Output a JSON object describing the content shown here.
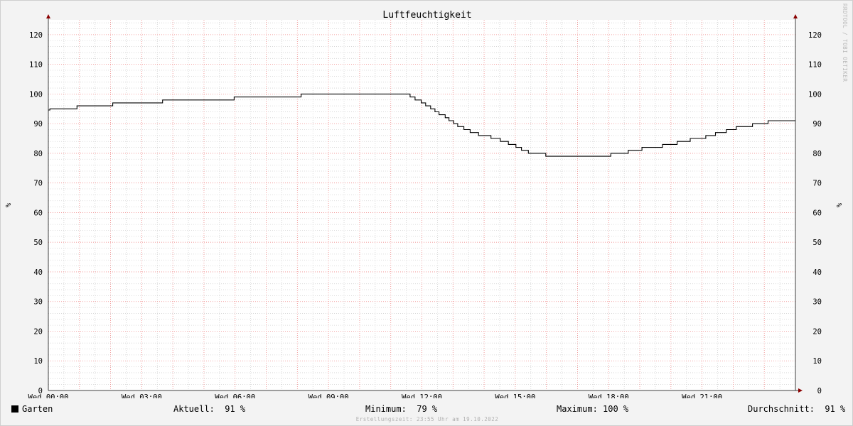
{
  "chart_data": {
    "type": "line",
    "title": "Luftfeuchtigkeit",
    "ylabel": "%",
    "ylabel_right": "%",
    "ylim": [
      0,
      125
    ],
    "yticks": [
      0,
      10,
      20,
      30,
      40,
      50,
      60,
      70,
      80,
      90,
      100,
      110,
      120
    ],
    "xlim_hours": [
      0,
      24
    ],
    "xticks": [
      {
        "hour": 0,
        "label": "Wed 00:00"
      },
      {
        "hour": 3,
        "label": "Wed 03:00"
      },
      {
        "hour": 6,
        "label": "Wed 06:00"
      },
      {
        "hour": 9,
        "label": "Wed 09:00"
      },
      {
        "hour": 12,
        "label": "Wed 12:00"
      },
      {
        "hour": 15,
        "label": "Wed 15:00"
      },
      {
        "hour": 18,
        "label": "Wed 18:00"
      },
      {
        "hour": 21,
        "label": "Wed 21:00"
      }
    ],
    "grid": true,
    "series": [
      {
        "name": "Garten",
        "color": "#000000",
        "points": [
          [
            0.0,
            94.6
          ],
          [
            0.05,
            95
          ],
          [
            0.92,
            96
          ],
          [
            2.07,
            97
          ],
          [
            3.67,
            98
          ],
          [
            5.97,
            99
          ],
          [
            8.12,
            100
          ],
          [
            11.62,
            99
          ],
          [
            11.78,
            98
          ],
          [
            11.98,
            97
          ],
          [
            12.12,
            96
          ],
          [
            12.28,
            95
          ],
          [
            12.42,
            94
          ],
          [
            12.55,
            93
          ],
          [
            12.75,
            92
          ],
          [
            12.87,
            91
          ],
          [
            13.02,
            90
          ],
          [
            13.15,
            89
          ],
          [
            13.35,
            88
          ],
          [
            13.55,
            87
          ],
          [
            13.82,
            86
          ],
          [
            14.22,
            85
          ],
          [
            14.52,
            84
          ],
          [
            14.78,
            83
          ],
          [
            15.02,
            82
          ],
          [
            15.2,
            81
          ],
          [
            15.42,
            80
          ],
          [
            15.98,
            79
          ],
          [
            18.07,
            80
          ],
          [
            18.63,
            81
          ],
          [
            19.07,
            82
          ],
          [
            19.73,
            83
          ],
          [
            20.2,
            84
          ],
          [
            20.62,
            85
          ],
          [
            21.12,
            86
          ],
          [
            21.43,
            87
          ],
          [
            21.78,
            88
          ],
          [
            22.1,
            89
          ],
          [
            22.62,
            90
          ],
          [
            23.12,
            91
          ],
          [
            24.0,
            91
          ]
        ]
      }
    ]
  },
  "legend": {
    "series_name": "Garten",
    "current_label": "Aktuell:",
    "current_value": "91 %",
    "min_label": "Minimum:",
    "min_value": "79 %",
    "max_label": "Maximum:",
    "max_value": "100 %",
    "avg_label": "Durchschnitt:",
    "avg_value": "91 %"
  },
  "footer_text": "Erstellungszeit: 23:55 Uhr am 19.10.2022",
  "watermark": "RRDTOOL / TOBI OETIKER"
}
